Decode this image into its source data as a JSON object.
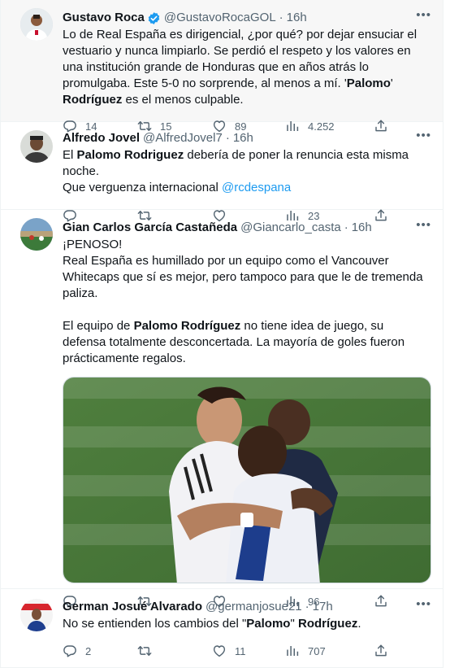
{
  "tweets": [
    {
      "name": "Gustavo Roca",
      "handle": "@GustavoRocaGOL",
      "time": "16h",
      "verified": true,
      "text": [
        {
          "t": "Lo de Real España es dirigencial, ¿por qué? por dejar ensuciar el vestuario y nunca limpiarlo.  Se perdió el respeto y los valores en una institución grande de Honduras que en años atrás lo promulgaba. Este 5-0 no sorprende, al menos a mí. '"
        },
        {
          "b": "Palomo"
        },
        {
          "t": "' "
        },
        {
          "b": "Rodríguez"
        },
        {
          "t": " es el menos culpable."
        }
      ],
      "replies": "14",
      "retweets": "15",
      "likes": "89",
      "views": "4.252"
    },
    {
      "name": "Alfredo Jovel",
      "handle": "@AlfredJovel7",
      "time": "16h",
      "line1_pre": "El ",
      "line1_bold": "Palomo Rodriguez",
      "line1_post": " debería de poner la renuncia esta misma noche.",
      "line2_pre": "Que verguenza internacional ",
      "mention": "@rcdespana",
      "replies": "",
      "retweets": "",
      "likes": "",
      "views": "23"
    },
    {
      "name": "Gian Carlos García Castañeda",
      "handle": "@Giancarlo_casta",
      "time": "16h",
      "p1": "¡PENOSO!",
      "p2": "Real España es humillado por un equipo como el Vancouver Whitecaps que sí es mejor, pero tampoco para que le de tremenda paliza.",
      "p3_pre": "El equipo de ",
      "p3_bold": "Palomo Rodríguez",
      "p3_post": " no tiene idea de juego, su defensa totalmente desconcertada. La mayoría de goles fueron prácticamente regalos.",
      "replies": "",
      "retweets": "",
      "likes": "",
      "views": "96"
    },
    {
      "name": "German Josué Alvarado",
      "handle": "@germanjosue21",
      "time": "17h",
      "t_pre": "No se entienden los cambios del \"",
      "t_bold1": "Palomo",
      "t_mid": "\" ",
      "t_bold2": "Rodríguez",
      "t_post": ".",
      "replies": "2",
      "retweets": "",
      "likes": "11",
      "views": "707"
    }
  ],
  "icons": {
    "reply": "reply-icon",
    "retweet": "retweet-icon",
    "like": "heart-icon",
    "views": "views-icon",
    "share": "share-icon",
    "more": "more-icon",
    "verified": "verified-badge-icon"
  },
  "colors": {
    "link": "#1d9bf0",
    "secondary": "#536471",
    "highlight_bg": "#f7f7f7"
  }
}
